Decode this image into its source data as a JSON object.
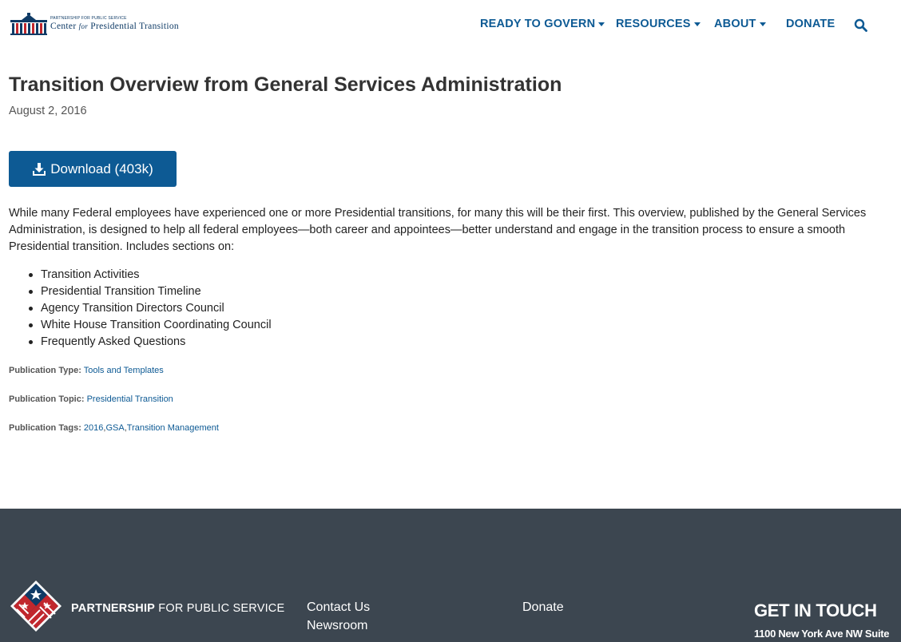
{
  "header": {
    "logo_small": "Partnership for Public Service",
    "logo_main_1": "Center",
    "logo_main_for": "for",
    "logo_main_2": "Presidential Transition",
    "nav": [
      {
        "label": "READY TO GOVERN",
        "has_dropdown": true
      },
      {
        "label": "RESOURCES",
        "has_dropdown": true
      },
      {
        "label": "ABOUT",
        "has_dropdown": true
      },
      {
        "label": "DONATE",
        "has_dropdown": false
      }
    ],
    "search_icon": "search-icon"
  },
  "main": {
    "title": "Transition Overview from General Services Administration",
    "date": "August 2, 2016",
    "download_label": "Download (403k)",
    "description": "While many Federal employees have experienced one or more Presidential transitions, for many this will be their first. This overview, published by the General Services Administration, is designed to help all federal employees—both career and appointees—better understand and engage in the transition process to ensure a smooth Presidential transition. Includes sections on:",
    "sections": [
      "Transition Activities",
      "Presidential Transition Timeline",
      "Agency Transition Directors Council",
      "White House Transition Coordinating Council",
      "Frequently Asked Questions"
    ],
    "publication_type_label": "Publication Type:",
    "publication_type": "Tools and Templates",
    "publication_topic_label": "Publication Topic:",
    "publication_topic": "Presidential Transition",
    "publication_tags_label": "Publication Tags:",
    "publication_tags": [
      "2016",
      "GSA",
      "Transition Management"
    ]
  },
  "footer": {
    "brand_bold": "PARTNERSHIP",
    "brand_regular": "FOR PUBLIC SERVICE",
    "links": [
      "Contact Us",
      "Newsroom",
      "Donate"
    ],
    "get_in_touch": "GET IN TOUCH",
    "address": "1100 New York Ave NW Suite"
  },
  "colors": {
    "brand_blue": "#0d5a94",
    "footer_bg": "#3c4650",
    "logo_navy": "#0f3b66",
    "logo_red": "#c1272d"
  }
}
